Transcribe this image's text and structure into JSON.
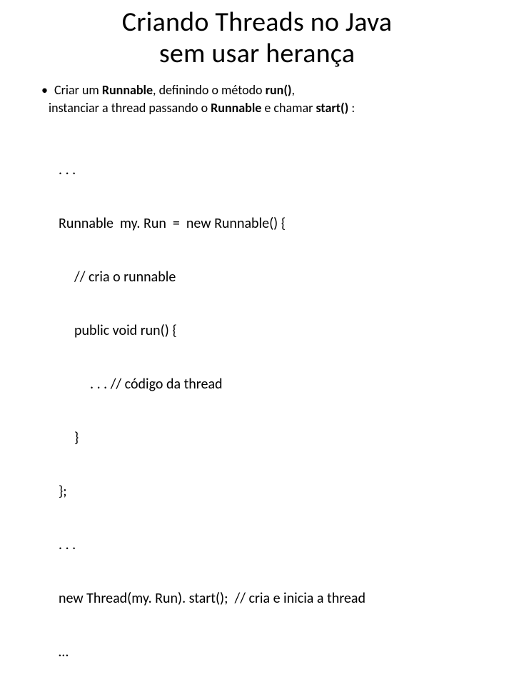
{
  "title": {
    "line1": "Criando Threads no Java",
    "line2": "sem usar herança"
  },
  "bullet": {
    "seg1": "Criar um ",
    "runnable": "Runnable",
    "seg2": ", definindo o método ",
    "run": "run()",
    "seg3": ",",
    "line2a": "instanciar a thread passando o ",
    "runnable2": "Runnable",
    "line2b": " e chamar ",
    "start": "start()",
    "line2c": " :"
  },
  "code": {
    "l1": ". . .",
    "l2": "Runnable  my. Run  =  new Runnable() {",
    "l3": "// cria o runnable",
    "l4": "public void run() {",
    "l5": ". . . // código da thread",
    "l6": "}",
    "l7": "};",
    "l8": ". . .",
    "l9": "new Thread(my. Run). start();  // cria e inicia a thread",
    "l10": "…"
  }
}
